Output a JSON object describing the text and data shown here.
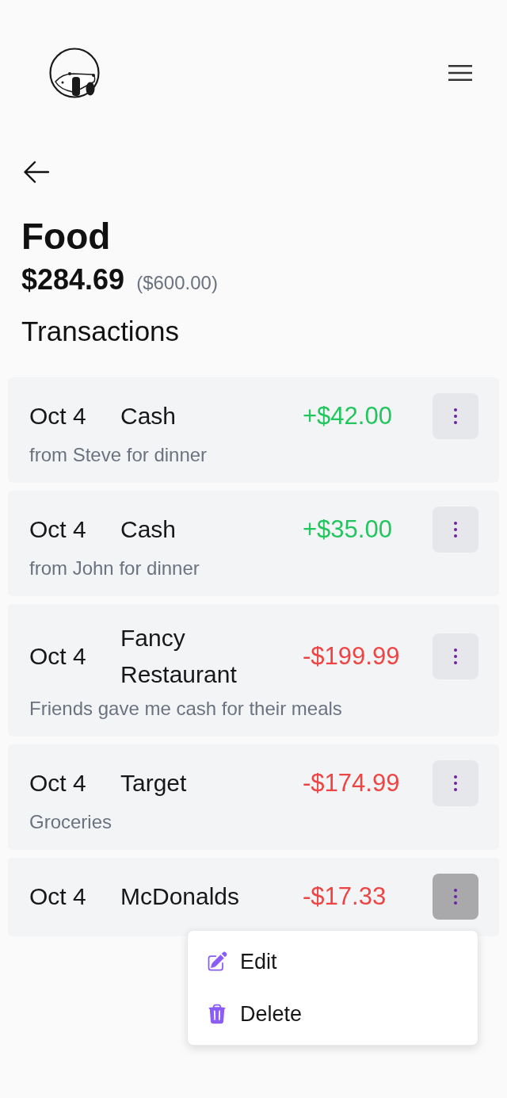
{
  "page": {
    "title": "Food",
    "spent": "$284.69",
    "budget": "($600.00)",
    "section_title": "Transactions"
  },
  "transactions": [
    {
      "date": "Oct 4",
      "name": "Cash",
      "amount": "+$42.00",
      "kind": "income",
      "note": "from Steve for dinner",
      "menu_open": false
    },
    {
      "date": "Oct 4",
      "name": "Cash",
      "amount": "+$35.00",
      "kind": "income",
      "note": "from John for dinner",
      "menu_open": false
    },
    {
      "date": "Oct 4",
      "name": "Fancy Restaurant",
      "amount": "-$199.99",
      "kind": "expense",
      "note": "Friends gave me cash for their meals",
      "menu_open": false
    },
    {
      "date": "Oct 4",
      "name": "Target",
      "amount": "-$174.99",
      "kind": "expense",
      "note": "Groceries",
      "menu_open": false
    },
    {
      "date": "Oct 4",
      "name": "McDonalds",
      "amount": "-$17.33",
      "kind": "expense",
      "menu_open": true
    }
  ],
  "menu": {
    "items": [
      {
        "label": "Edit",
        "kind": "edit"
      },
      {
        "label": "Delete",
        "kind": "delete"
      }
    ]
  }
}
